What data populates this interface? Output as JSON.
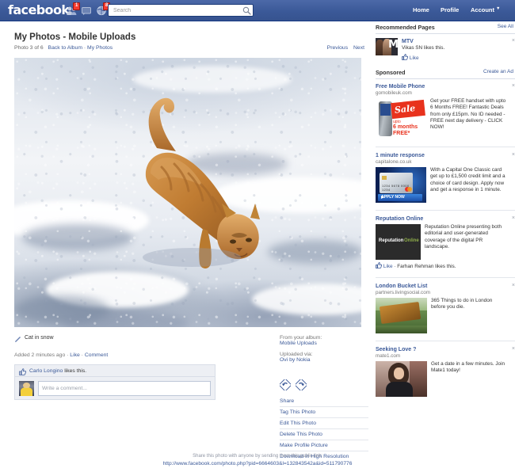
{
  "topbar": {
    "logo": "facebook",
    "icons": [
      {
        "name": "friend-requests-icon",
        "badge": "1"
      },
      {
        "name": "messages-icon",
        "badge": ""
      },
      {
        "name": "notifications-icon",
        "badge": "8"
      }
    ],
    "search": {
      "placeholder": "Search",
      "value": ""
    },
    "nav": [
      {
        "label": "Home"
      },
      {
        "label": "Profile"
      },
      {
        "label": "Account"
      }
    ],
    "account_caret": "▼",
    "colors": {
      "brand_blue": "#3b5998",
      "badge_red": "#f53b2f"
    }
  },
  "page": {
    "title": "My Photos - Mobile Uploads",
    "photo_position": "Photo 3 of 6",
    "back_to_album": "Back to Album",
    "album_sep": "·",
    "my_photos": "My Photos",
    "previous": "Previous",
    "next": "Next"
  },
  "photo": {
    "alt": "Orange tabby cat walking through deep snow",
    "caption": "Cat in snow",
    "added": "Added 2 minutes ago",
    "like": "Like",
    "comment": "Comment",
    "sep": "·",
    "likes_text_person": "Carlo Longino",
    "likes_text_rest": " likes this.",
    "comment_placeholder": "Write a comment..."
  },
  "meta": {
    "album_label": "From your album:",
    "album_name": "Mobile Uploads",
    "via_label": "Uploaded via:",
    "via_name": "Ovi by Nokia",
    "rotate_left": "rotate-left-icon",
    "rotate_right": "rotate-right-icon",
    "actions": [
      {
        "label": "Share"
      },
      {
        "label": "Tag This Photo"
      },
      {
        "label": "Edit This Photo"
      },
      {
        "label": "Delete This Photo"
      },
      {
        "label": "Make Profile Picture"
      },
      {
        "label": "Download in High Resolution"
      }
    ]
  },
  "sidebar": {
    "recommended": {
      "heading": "Recommended Pages",
      "see_all": "See All",
      "item": {
        "title": "MTV",
        "social": "Vikas SN likes this.",
        "like": "Like",
        "close": "×"
      }
    },
    "sponsored": {
      "heading": "Sponsored",
      "create_ad": "Create an Ad",
      "ads": [
        {
          "title": "Free Mobile Phone",
          "url": "gomobileuk.com",
          "body": "Get your FREE handset with upto 6 Months FREE! Fantastic Deals from only £15pm. No ID needed - FREE next day delivery - CLICK NOW!",
          "close": "×",
          "thumb": "phone-sale-thumb",
          "thumb_text": {
            "sale": "Sale",
            "upto": "upto",
            "months": "6 months",
            "free": "FREE*"
          }
        },
        {
          "title": "1 minute response",
          "url": "capitalone.co.uk",
          "body": "With a Capital One Classic card get up to £1,500 credit limit and a choice of card design. Apply now and get a response in 1 minute.",
          "close": "×",
          "thumb": "capital-one-card-thumb",
          "thumb_text": {
            "apply": "APPLY NOW",
            "number": "1234  5678  0000  1234"
          }
        },
        {
          "title": "Reputation Online",
          "url": "",
          "body": "Reputation Online presenting both editorial and user-generated coverage of the digital PR landscape.",
          "close": "×",
          "thumb": "reputation-online-thumb",
          "thumb_text": {
            "a": "Reputation",
            "b": "Online"
          },
          "like": "Like",
          "social_sep": "·",
          "social": "Farhan Rehman likes this."
        },
        {
          "title": "London Bucket List",
          "url": "partners.livingsocial.com",
          "body": "365 Things to do in London before you die.",
          "close": "×",
          "thumb": "london-log-flume-thumb"
        },
        {
          "title": "Seeking Love ?",
          "url": "mate1.com",
          "body": "Get a date in a few minutes. Join Mate1 today!",
          "close": "×",
          "thumb": "dating-woman-thumb"
        }
      ]
    }
  },
  "footer": {
    "note": "Share this photo with anyone by sending them this public link:",
    "link": "http://www.facebook.com/photo.php?pid=6664603&l=132843542a&id=511790776"
  }
}
